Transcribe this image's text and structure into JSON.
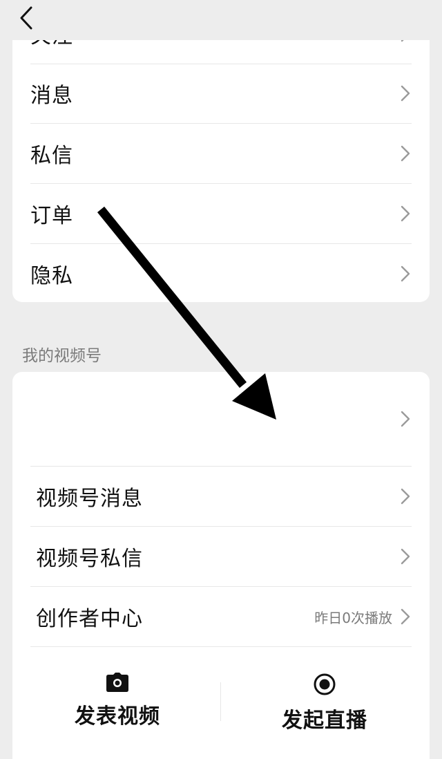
{
  "menu_group_1": {
    "items": [
      {
        "label": "关注"
      },
      {
        "label": "消息"
      },
      {
        "label": "私信"
      },
      {
        "label": "订单"
      },
      {
        "label": "隐私"
      }
    ]
  },
  "channels_section": {
    "title": "我的视频号",
    "items": [
      {
        "label": ""
      },
      {
        "label": "视频号消息"
      },
      {
        "label": "视频号私信"
      },
      {
        "label": "创作者中心",
        "hint": "昨日0次播放"
      }
    ],
    "actions": [
      {
        "label": "发表视频",
        "icon": "camera-icon"
      },
      {
        "label": "发起直播",
        "icon": "live-record-icon"
      }
    ]
  },
  "annotation": {
    "icon": "pointer-arrow-icon",
    "color": "#000000"
  }
}
